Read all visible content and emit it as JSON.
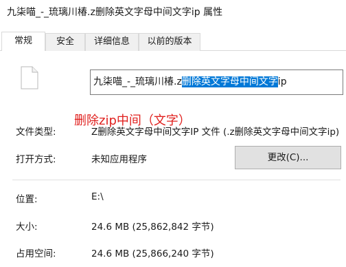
{
  "window": {
    "title": "九柒喵_-_琉璃川椿.z删除英文字母中间文字ip 属性"
  },
  "tabs": [
    {
      "label": "常规",
      "active": true
    },
    {
      "label": "安全",
      "active": false
    },
    {
      "label": "详细信息",
      "active": false
    },
    {
      "label": "以前的版本",
      "active": false
    }
  ],
  "general": {
    "file_icon": "blank-file-icon",
    "filename": {
      "before_selection": "九柒喵_-_琉璃川椿.z",
      "selected": "删除英文字母中间文字",
      "after_selection": "ip"
    },
    "annotation": "删除zip中间（文字）",
    "annotation_color": "#e0201e",
    "selection_color": "#0078d7",
    "file_type": {
      "label": "文件类型:",
      "value": "Z删除英文字母中间文字IP 文件 (.z删除英文字母中间文字ip)"
    },
    "opens_with": {
      "label": "打开方式:",
      "value": "未知应用程序",
      "change_button": "更改(C)..."
    },
    "location": {
      "label": "位置:",
      "value": "E:\\"
    },
    "size": {
      "label": "大小:",
      "value": "24.6 MB (25,862,842 字节)"
    },
    "size_on_disk": {
      "label": "占用空间:",
      "value": "24.6 MB (25,866,240 字节)"
    }
  }
}
